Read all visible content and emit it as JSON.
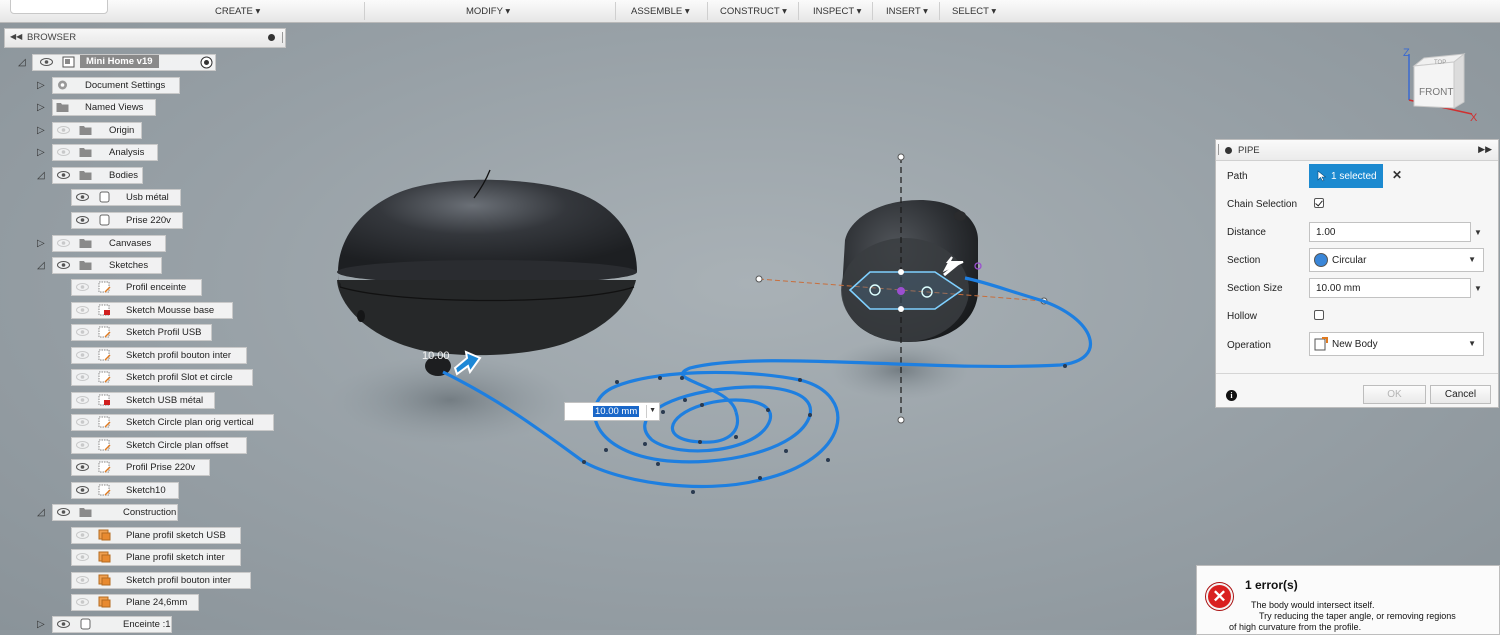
{
  "toolbar": {
    "menus": [
      {
        "label": "CREATE ▾"
      },
      {
        "label": "MODIFY ▾"
      },
      {
        "label": "ASSEMBLE ▾"
      },
      {
        "label": "CONSTRUCT ▾"
      },
      {
        "label": "INSPECT ▾"
      },
      {
        "label": "INSERT ▾"
      },
      {
        "label": "SELECT ▾"
      }
    ]
  },
  "browser": {
    "title": "BROWSER",
    "root": "Mini Home v19",
    "items": [
      {
        "label": "Document Settings"
      },
      {
        "label": "Named Views"
      },
      {
        "label": "Origin"
      },
      {
        "label": "Analysis"
      },
      {
        "label": "Bodies"
      },
      {
        "label": "Usb métal"
      },
      {
        "label": "Prise 220v"
      },
      {
        "label": "Canvases"
      },
      {
        "label": "Sketches"
      },
      {
        "label": "Profil enceinte"
      },
      {
        "label": "Sketch Mousse base"
      },
      {
        "label": "Sketch Profil USB"
      },
      {
        "label": "Sketch profil bouton inter"
      },
      {
        "label": "Sketch profil Slot et circle"
      },
      {
        "label": "Sketch USB métal"
      },
      {
        "label": "Sketch Circle plan orig vertical"
      },
      {
        "label": "Sketch Circle plan offset"
      },
      {
        "label": "Profil Prise 220v"
      },
      {
        "label": "Sketch10"
      },
      {
        "label": "Construction"
      },
      {
        "label": "Plane profil sketch USB"
      },
      {
        "label": "Plane profil sketch inter"
      },
      {
        "label": "Sketch profil  bouton inter"
      },
      {
        "label": "Plane 24,6mm"
      },
      {
        "label": "Enceinte :1"
      }
    ]
  },
  "viewcube": {
    "face": "FRONT",
    "top": "TOP",
    "axis_z": "Z",
    "axis_x": "X"
  },
  "pipe": {
    "title": "PIPE",
    "path_label": "Path",
    "path_value": "1 selected",
    "chain_label": "Chain Selection",
    "chain_checked": true,
    "distance_label": "Distance",
    "distance_value": "1.00",
    "section_label": "Section",
    "section_value": "Circular",
    "section_size_label": "Section Size",
    "section_size_value": "10.00 mm",
    "hollow_label": "Hollow",
    "hollow_checked": false,
    "operation_label": "Operation",
    "operation_value": "New Body",
    "ok_label": "OK",
    "cancel_label": "Cancel"
  },
  "canvas": {
    "inline_input_value": "10.00 mm",
    "dim_label": "10.00"
  },
  "error": {
    "title": "1 error(s)",
    "line1": "The body would intersect itself.",
    "line2": "Try reducing the taper angle, or removing regions",
    "line3": "of high curvature from the profile."
  },
  "colors": {
    "accent": "#1c8ad0",
    "path": "#1e7fe0",
    "error": "#d92020"
  }
}
